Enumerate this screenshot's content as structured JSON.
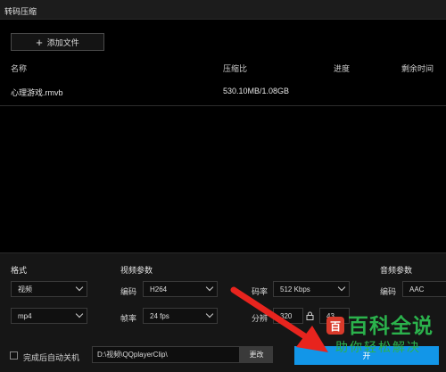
{
  "window": {
    "title": "转码压缩"
  },
  "toolbar": {
    "add_label": "添加文件"
  },
  "table": {
    "headers": {
      "name": "名称",
      "ratio": "压缩比",
      "progress": "进度",
      "remaining": "剩余时间"
    },
    "rows": [
      {
        "name": "心理游戏.rmvb",
        "ratio": "530.10MB/1.08GB"
      }
    ]
  },
  "settings": {
    "format": {
      "section": "格式",
      "type_value": "视频",
      "container_value": "mp4"
    },
    "video": {
      "section": "视频参数",
      "codec_label": "编码",
      "codec_value": "H264",
      "fps_label": "帧率",
      "fps_value": "24 fps",
      "bitrate_label": "码率",
      "bitrate_value": "512 Kbps",
      "resolution_label": "分辨",
      "width_value": "320",
      "height_value": "43"
    },
    "audio": {
      "section": "音频参数",
      "codec_label": "编码",
      "codec_value": "AAC"
    }
  },
  "footer": {
    "shutdown_label": "完成后自动关机",
    "output_path": "D:\\视频\\QQplayerClip\\",
    "change_label": "更改",
    "start_label": "开"
  },
  "watermark": {
    "logo": "百",
    "main": "百科全说",
    "sub": "助你轻松解决"
  },
  "colors": {
    "accent": "#1296e8",
    "arrow": "#e8241e",
    "watermark": "#2bb24c"
  }
}
